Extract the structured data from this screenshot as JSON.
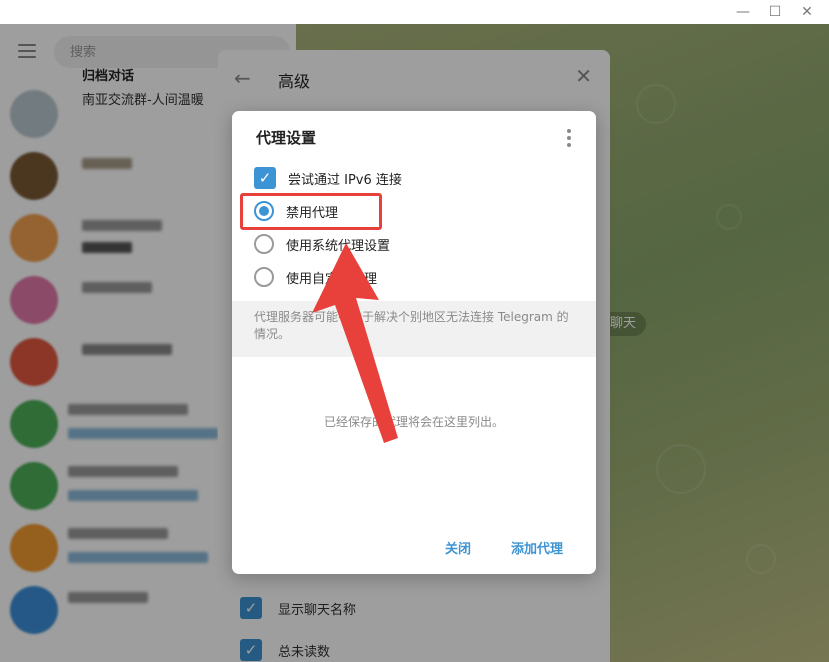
{
  "window": {
    "minimize_glyph": "—",
    "maximize_glyph": "☐",
    "close_glyph": "✕"
  },
  "sidebar": {
    "search_placeholder": "搜索",
    "first_chat": {
      "title": "归档对话",
      "subtitle": "南亚交流群-人间温暖"
    }
  },
  "settings_panel": {
    "title": "高级",
    "rows": [
      {
        "label": "显示聊天名称"
      },
      {
        "label": "总未读数"
      }
    ]
  },
  "background": {
    "service_pill": "聊天"
  },
  "dialog": {
    "title": "代理设置",
    "options": [
      {
        "label": "尝试通过 IPv6 连接",
        "type": "checkbox",
        "checked": true
      },
      {
        "label": "禁用代理",
        "type": "radio",
        "checked": true
      },
      {
        "label": "使用系统代理设置",
        "type": "radio",
        "checked": false
      },
      {
        "label": "使用自定义代理",
        "type": "radio",
        "checked": false
      }
    ],
    "note": "代理服务器可能有助于解决个别地区无法连接 Telegram 的情况。",
    "empty_text": "已经保存的代理将会在这里列出。",
    "close_button": "关闭",
    "add_button": "添加代理"
  },
  "colors": {
    "accent": "#3d94d4",
    "annotation_red": "#e8413c"
  }
}
